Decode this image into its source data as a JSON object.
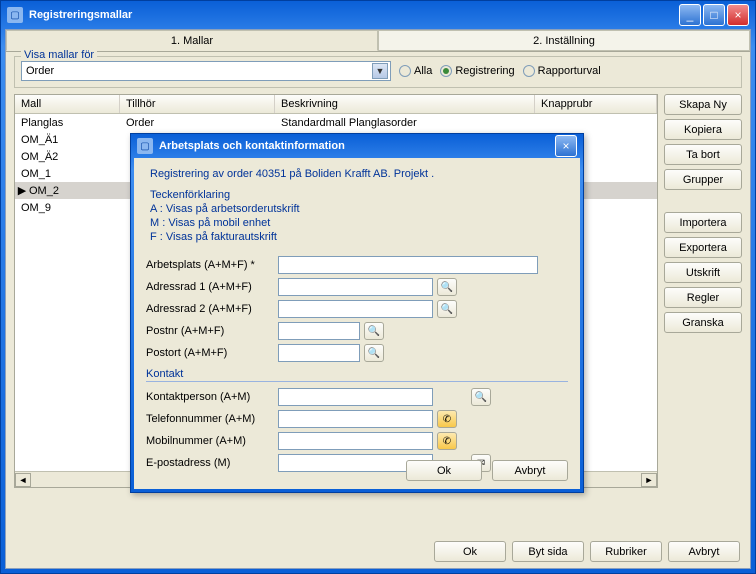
{
  "window": {
    "title": "Registreringsmallar",
    "min_label": "_",
    "max_label": "□",
    "close_label": "×"
  },
  "tabs": [
    {
      "label": "1. Mallar"
    },
    {
      "label": "2. Inställning"
    }
  ],
  "filter": {
    "legend": "Visa mallar för",
    "combo_value": "Order",
    "radios": [
      {
        "label": "Alla",
        "selected": false
      },
      {
        "label": "Registrering",
        "selected": true
      },
      {
        "label": "Rapporturval",
        "selected": false
      }
    ]
  },
  "table": {
    "columns": [
      "Mall",
      "Tillhör",
      "Beskrivning",
      "Knapprubr"
    ],
    "rows": [
      {
        "c0": "Planglas",
        "c1": "Order",
        "c2": "Standardmall Planglasorder",
        "c3": ""
      },
      {
        "c0": "OM_Ä1",
        "c1": "",
        "c2": "",
        "c3": ""
      },
      {
        "c0": "OM_Ä2",
        "c1": "",
        "c2": "",
        "c3": ""
      },
      {
        "c0": "OM_1",
        "c1": "",
        "c2": "",
        "c3": ""
      },
      {
        "c0": "OM_2",
        "c1": "",
        "c2": "",
        "c3": ""
      },
      {
        "c0": "OM_9",
        "c1": "",
        "c2": "",
        "c3": ""
      }
    ],
    "selected_index": 4
  },
  "side_buttons": {
    "group1": [
      "Skapa Ny",
      "Kopiera",
      "Ta bort",
      "Grupper"
    ],
    "group2": [
      "Importera",
      "Exportera",
      "Utskrift",
      "Regler",
      "Granska"
    ]
  },
  "footer_buttons": [
    "Ok",
    "Byt sida",
    "Rubriker",
    "Avbryt"
  ],
  "modal": {
    "title": "Arbetsplats och kontaktinformation",
    "header": "Registrering av order 40351 på Boliden Krafft AB. Projekt .",
    "legend_title": "Teckenförklaring",
    "legend_a": "A : Visas på arbetsorderutskrift",
    "legend_m": "M : Visas på mobil enhet",
    "legend_f": "F : Visas på fakturautskrift",
    "fields": {
      "arbetsplats": "Arbetsplats (A+M+F) *",
      "adress1": "Adressrad 1 (A+M+F)",
      "adress2": "Adressrad 2 (A+M+F)",
      "postnr": "Postnr (A+M+F)",
      "postort": "Postort (A+M+F)"
    },
    "section_kontakt": "Kontakt",
    "kontakt_fields": {
      "kontaktperson": "Kontaktperson (A+M)",
      "telefon": "Telefonnummer (A+M)",
      "mobil": "Mobilnummer (A+M)",
      "epost": "E-postadress (M)"
    },
    "ok": "Ok",
    "cancel": "Avbryt"
  }
}
